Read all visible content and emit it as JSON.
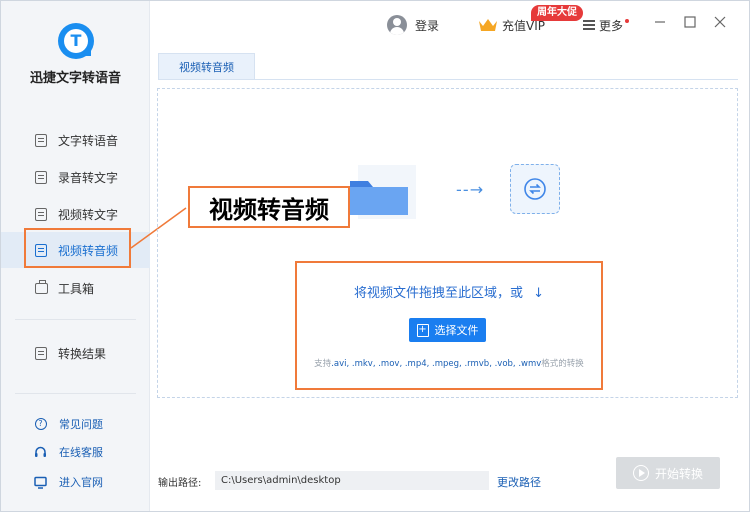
{
  "app": {
    "title": "迅捷文字转语音"
  },
  "sidebar": {
    "items": [
      {
        "label": "文字转语音",
        "icon": "text-to-speech-icon"
      },
      {
        "label": "录音转文字",
        "icon": "recording-to-text-icon"
      },
      {
        "label": "视频转文字",
        "icon": "video-to-text-icon"
      },
      {
        "label": "视频转音频",
        "icon": "video-to-audio-icon",
        "active": true
      },
      {
        "label": "工具箱",
        "icon": "toolbox-icon"
      },
      {
        "label": "转换结果",
        "icon": "results-icon"
      }
    ],
    "footer": [
      {
        "label": "常见问题",
        "icon": "question-icon"
      },
      {
        "label": "在线客服",
        "icon": "headset-icon"
      },
      {
        "label": "进入官网",
        "icon": "monitor-icon"
      }
    ]
  },
  "annotation": {
    "label": "视频转音频",
    "color": "#f07a3a"
  },
  "topbar": {
    "login": "登录",
    "vip": "充值VIP",
    "vip_badge": "周年大促",
    "more": "更多"
  },
  "tab": {
    "label": "视频转音频"
  },
  "dropzone": {
    "prompt": "将视频文件拖拽至此区域，或",
    "select_button": "选择文件",
    "formats_prefix": "支持",
    "formats": ".avi, .mkv, .mov, .mp4, .mpeg, .rmvb, .vob, .wmv",
    "formats_suffix": "格式的转换"
  },
  "footer": {
    "output_label": "输出路径:",
    "output_path": "C:\\Users\\admin\\desktop",
    "change_path": "更改路径",
    "start_button": "开始转换"
  },
  "colors": {
    "accent": "#1a7ef0",
    "annotation": "#f07a3a",
    "badge": "#e63a3a",
    "disabled": "#d9dcdf"
  }
}
